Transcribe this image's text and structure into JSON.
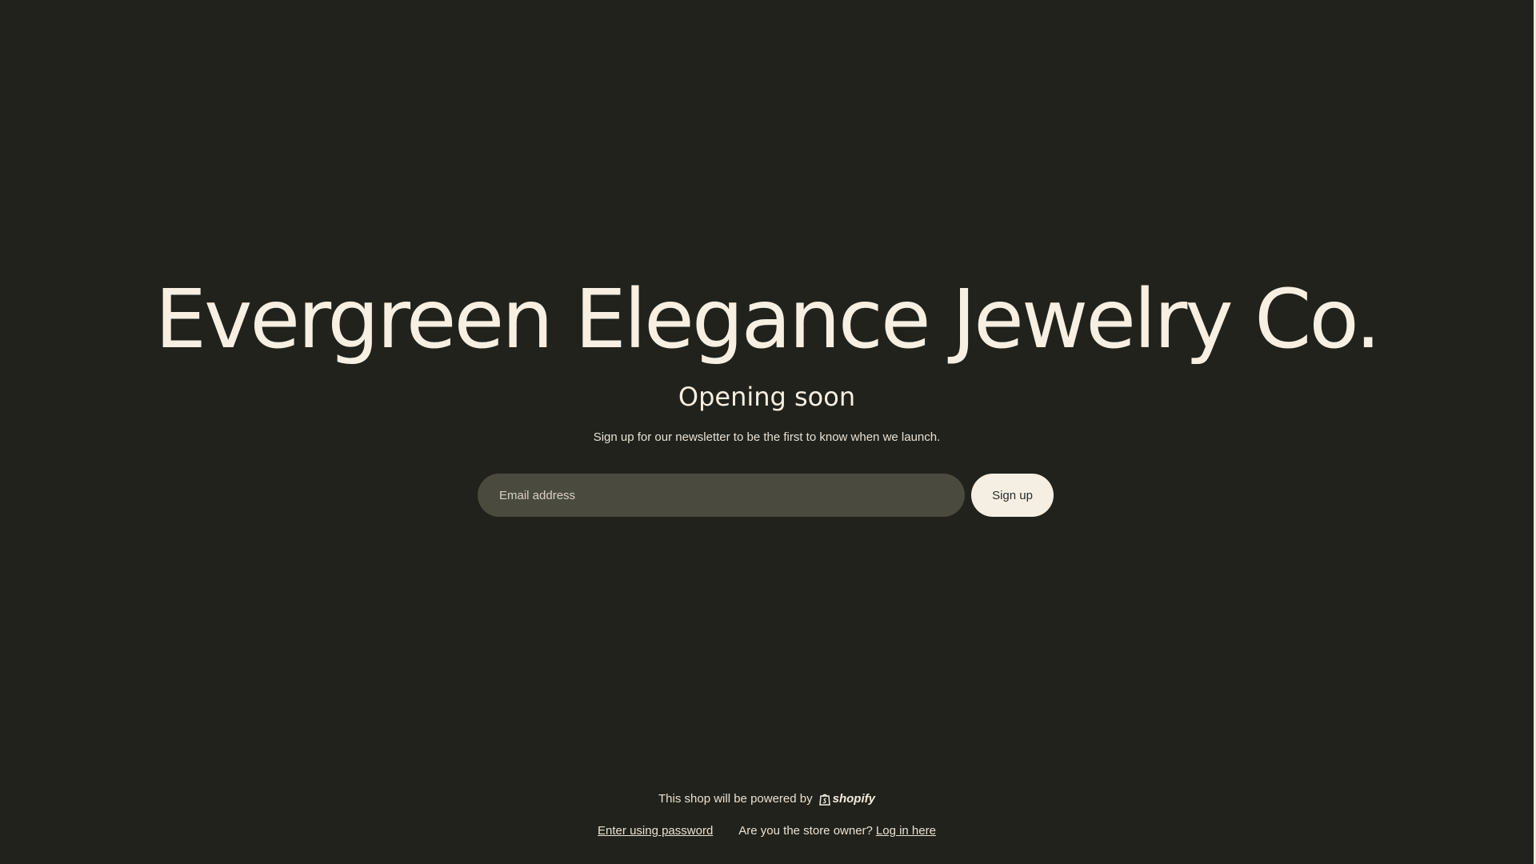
{
  "hero": {
    "shop_name": "Evergreen Elegance Jewelry Co.",
    "headline": "Opening soon",
    "subtext": "Sign up for our newsletter to be the first to know when we launch."
  },
  "newsletter": {
    "email_placeholder": "Email address",
    "email_value": "",
    "signup_label": "Sign up"
  },
  "footer": {
    "powered_by": "This shop will be powered by",
    "shopify_logo": "shopify",
    "enter_password": "Enter using password",
    "owner_prompt": "Are you the store owner?",
    "login_link": "Log in here"
  },
  "colors": {
    "background": "#21221c",
    "text": "#f6efe2",
    "field": "#4a4a3f",
    "button": "#f5efe3"
  },
  "icons": {
    "shopify": "shopify-bag-icon"
  }
}
